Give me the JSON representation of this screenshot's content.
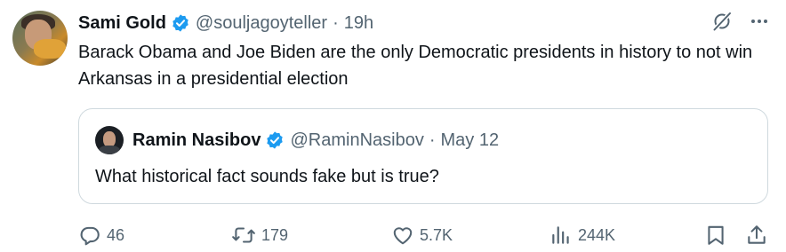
{
  "tweet": {
    "author_name": "Sami Gold",
    "handle": "@souljagoyteller",
    "separator": "·",
    "time": "19h",
    "text": "Barack Obama and Joe Biden are the only Democratic presidents in history to not win Arkansas in a presidential election"
  },
  "quoted": {
    "author_name": "Ramin Nasibov",
    "handle": "@RaminNasibov",
    "separator": "·",
    "date": "May 12",
    "text": "What historical fact sounds fake but is true?"
  },
  "actions": {
    "replies": "46",
    "reposts": "179",
    "likes": "5.7K",
    "views": "244K"
  },
  "icons": {
    "grok": "grok-icon",
    "more": "more-icon",
    "verified": "verified-badge-icon",
    "reply": "reply-icon",
    "repost": "repost-icon",
    "like": "like-icon",
    "views": "views-icon",
    "bookmark": "bookmark-icon",
    "share": "share-icon"
  },
  "colors": {
    "verified": "#1d9bf0",
    "secondary_text": "#536471",
    "primary_text": "#0f1419",
    "border": "#cfd9de"
  }
}
